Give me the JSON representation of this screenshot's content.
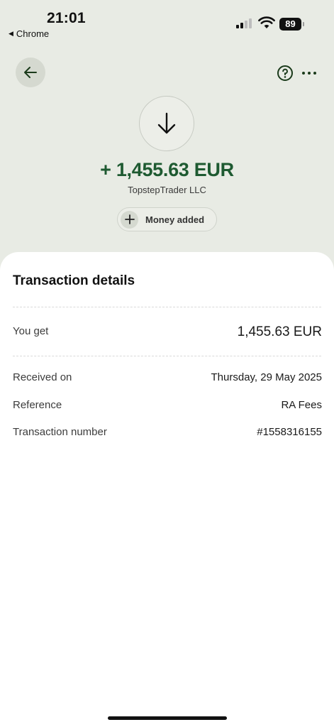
{
  "status_bar": {
    "time": "21:01",
    "back_app": "Chrome",
    "battery": "89"
  },
  "header": {
    "icons": [
      "arrow-left-icon",
      "question-circle-icon",
      "more-horizontal-icon"
    ]
  },
  "hero": {
    "icon": "arrow-down-icon",
    "amount": "+ 1,455.63 EUR",
    "merchant": "TopstepTrader LLC",
    "chip_label": "Money added",
    "accent_color": "#1e5a31"
  },
  "details": {
    "title": "Transaction details",
    "you_get_label": "You get",
    "you_get_value": "1,455.63 EUR",
    "rows": [
      {
        "label": "Received on",
        "value": "Thursday, 29 May 2025"
      },
      {
        "label": "Reference",
        "value": "RA Fees"
      },
      {
        "label": "Transaction number",
        "value": "#1558316155"
      }
    ]
  }
}
